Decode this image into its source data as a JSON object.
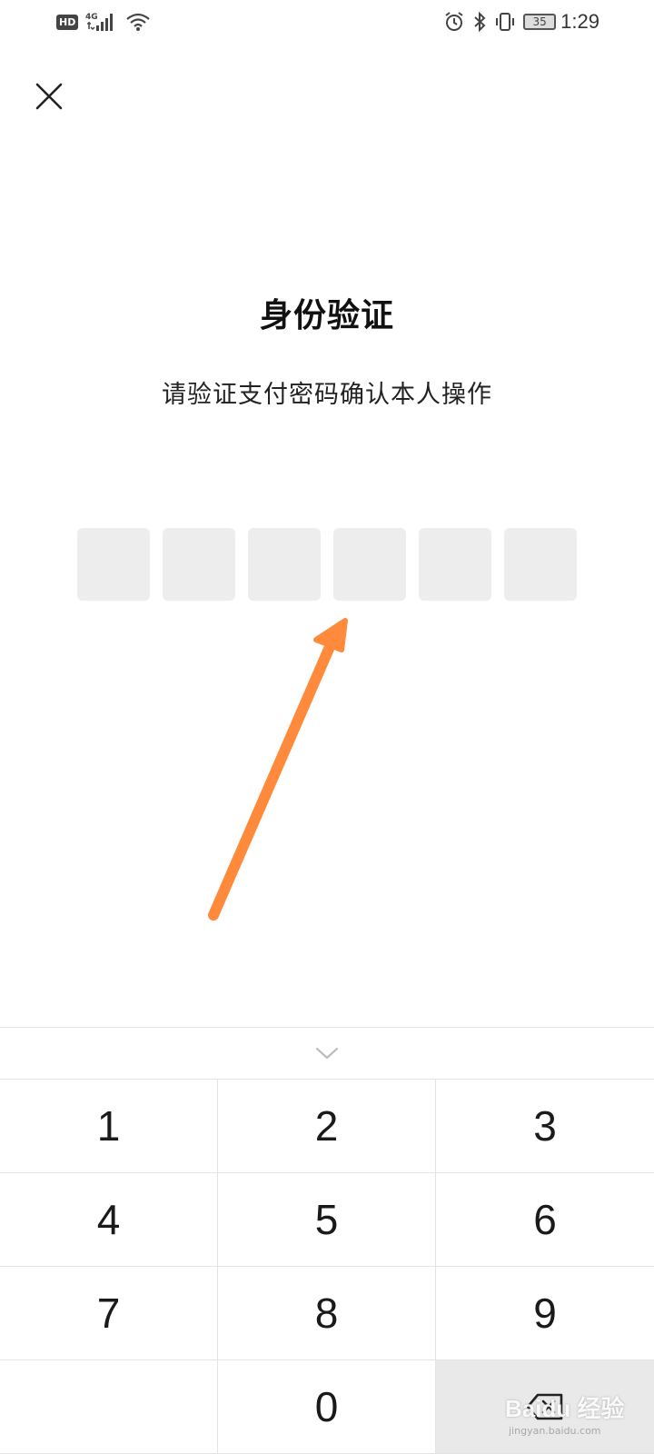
{
  "status_bar": {
    "network_badge": "HD",
    "network_type": "4G",
    "battery_level": "35",
    "time": "1:29",
    "icons": [
      "signal-icon",
      "wifi-icon",
      "alarm-icon",
      "bluetooth-icon",
      "vibrate-icon",
      "battery-icon"
    ]
  },
  "header": {
    "close_icon": "close-icon"
  },
  "verification": {
    "title": "身份验证",
    "subtitle": "请验证支付密码确认本人操作",
    "pin_length": 6
  },
  "annotation": {
    "color": "#FF8A3C",
    "type": "arrow"
  },
  "keypad": {
    "collapse_icon": "chevron-down-icon",
    "keys": [
      "1",
      "2",
      "3",
      "4",
      "5",
      "6",
      "7",
      "8",
      "9",
      "",
      "0",
      "backspace"
    ],
    "backspace_icon": "backspace-icon"
  },
  "watermark": {
    "logo": "Baidu 经验",
    "site": "jingyan.baidu.com"
  }
}
